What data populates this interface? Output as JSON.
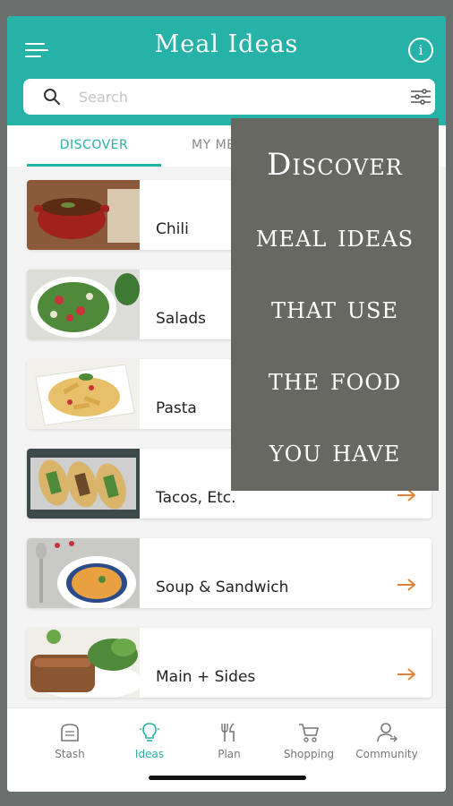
{
  "header": {
    "title": "Meal Ideas"
  },
  "search": {
    "placeholder": "Search"
  },
  "tabs": [
    {
      "label": "DISCOVER",
      "active": true
    },
    {
      "label": "MY MEALS",
      "active": false
    }
  ],
  "meals": [
    {
      "label": "Chili"
    },
    {
      "label": "Salads"
    },
    {
      "label": "Pasta"
    },
    {
      "label": "Tacos, Etc."
    },
    {
      "label": "Soup & Sandwich"
    },
    {
      "label": "Main + Sides"
    }
  ],
  "bottom_nav": [
    {
      "label": "Stash",
      "icon": "toast-icon",
      "active": false
    },
    {
      "label": "Ideas",
      "icon": "lightbulb-icon",
      "active": true
    },
    {
      "label": "Plan",
      "icon": "utensils-icon",
      "active": false
    },
    {
      "label": "Shopping",
      "icon": "cart-icon",
      "active": false
    },
    {
      "label": "Community",
      "icon": "community-icon",
      "active": false
    }
  ],
  "overlay": {
    "lines": [
      "Discover",
      "meal ideas",
      "that use",
      "the food",
      "you have"
    ]
  },
  "colors": {
    "accent": "#27b2a7",
    "arrow": "#e0823a",
    "overlay": "#686862"
  }
}
